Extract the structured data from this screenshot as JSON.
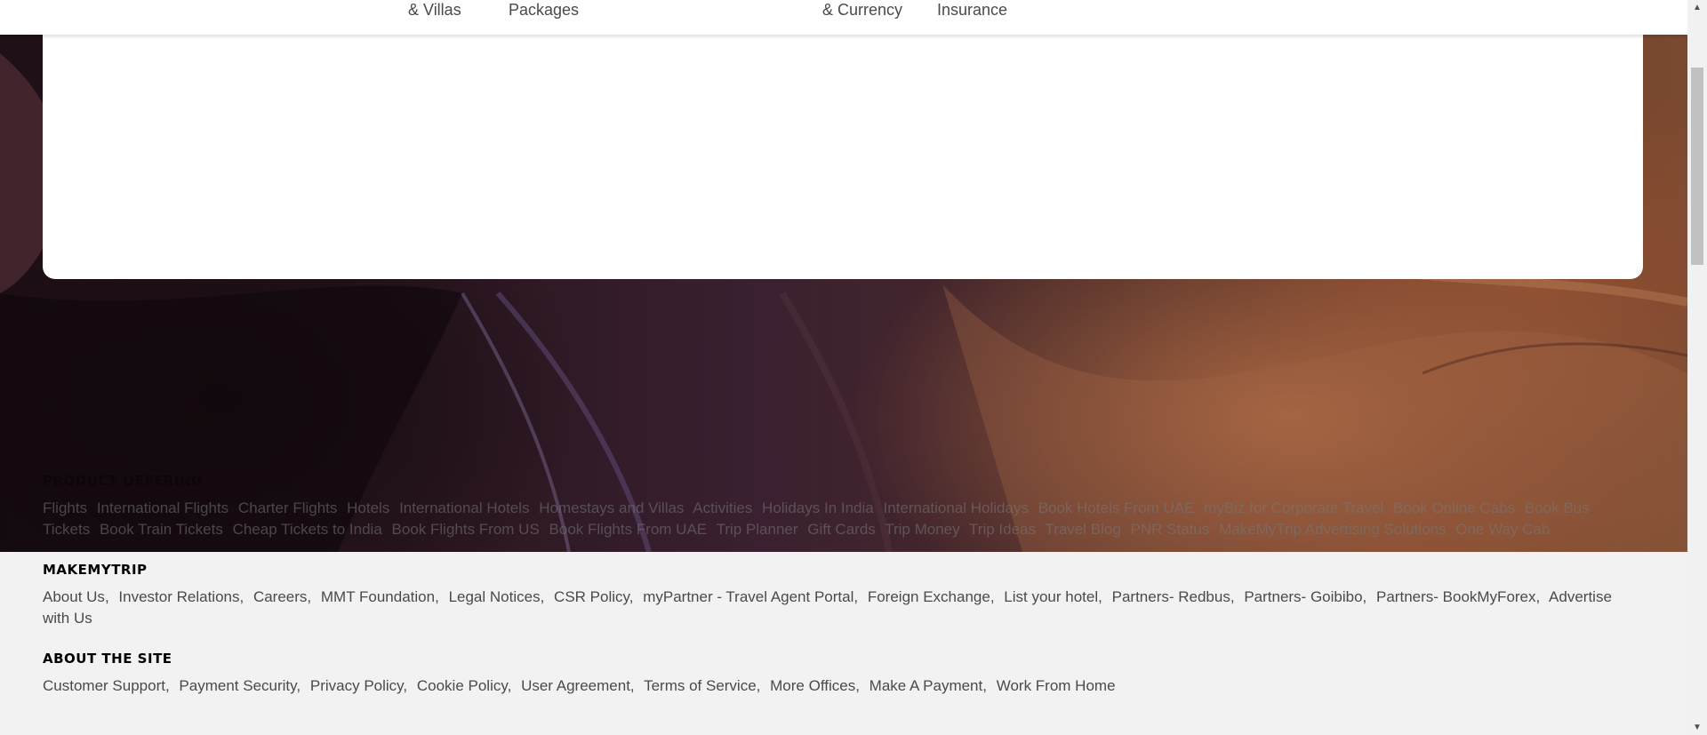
{
  "topnav": {
    "items": [
      "& Villas",
      "Packages",
      "& Currency",
      "Insurance"
    ]
  },
  "footer": {
    "product_offering": {
      "title": "PRODUCT OFFERING",
      "links": [
        "Flights",
        "International Flights",
        "Charter Flights",
        "Hotels",
        "International Hotels",
        "Homestays and Villas",
        "Activities",
        "Holidays In India",
        "International Holidays",
        "Book Hotels From UAE",
        "myBiz for Corporate Travel",
        "Book Online Cabs",
        "Book Bus Tickets",
        "Book Train Tickets",
        "Cheap Tickets to India",
        "Book Flights From US",
        "Book Flights From UAE",
        "Trip Planner",
        "Gift Cards",
        "Trip Money",
        "Trip Ideas",
        "Travel Blog",
        "PNR Status",
        "MakeMyTrip Advertising Solutions",
        "One Way Cab"
      ]
    },
    "makemytrip": {
      "title": "MAKEMYTRIP",
      "links": [
        "About Us",
        "Investor Relations",
        "Careers",
        "MMT Foundation",
        "Legal Notices",
        "CSR Policy",
        "myPartner - Travel Agent Portal",
        "Foreign Exchange",
        "List your hotel",
        "Partners- Redbus",
        "Partners- Goibibo",
        "Partners- BookMyForex",
        "Advertise with Us"
      ]
    },
    "about_site": {
      "title": "ABOUT THE SITE",
      "links": [
        "Customer Support",
        "Payment Security",
        "Privacy Policy",
        "Cookie Policy",
        "User Agreement",
        "Terms of Service",
        "More Offices",
        "Make A Payment",
        "Work From Home"
      ]
    }
  },
  "scrollbar": {
    "up_icon": "▲",
    "down_icon": "▼"
  }
}
